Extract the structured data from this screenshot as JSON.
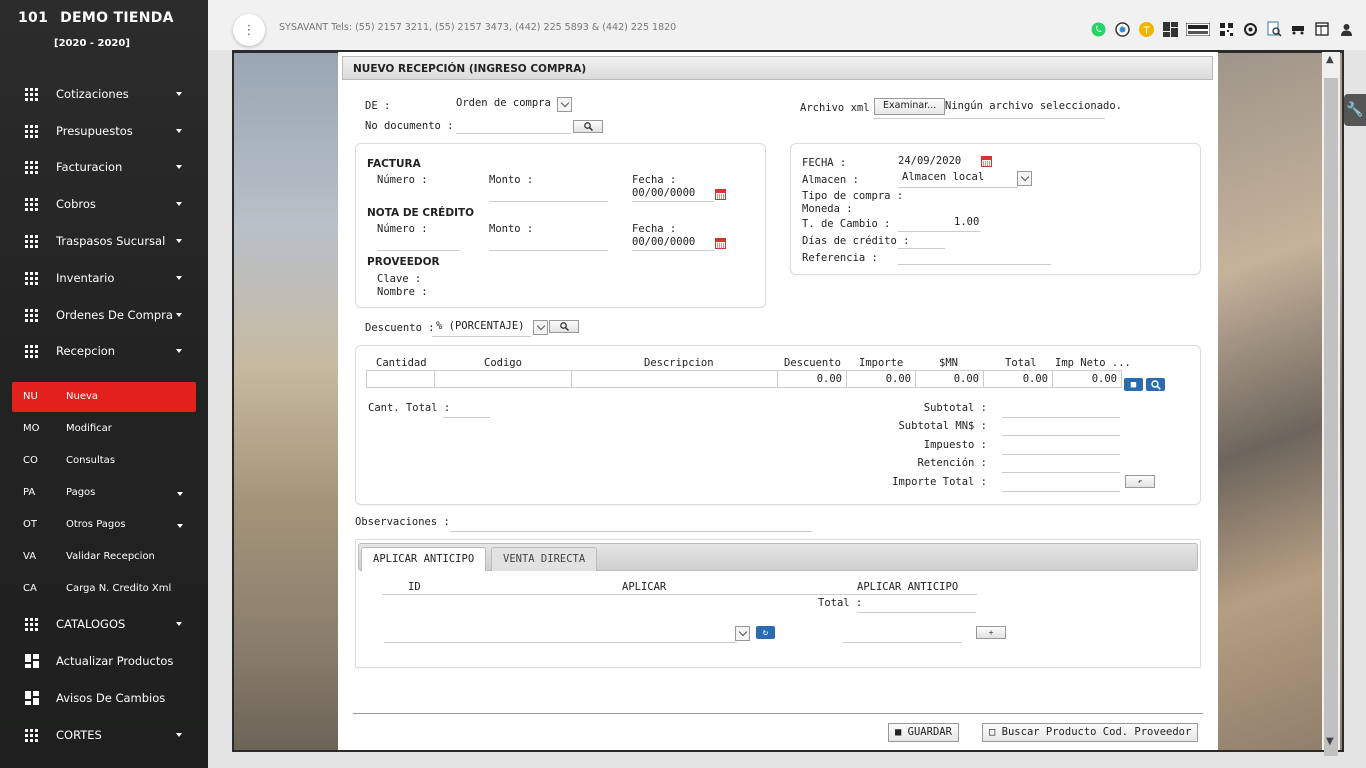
{
  "brand": {
    "number": "101",
    "name": "DEMO TIENDA",
    "period": "[2020 - 2020]"
  },
  "menu": [
    {
      "label": "Cotizaciones",
      "icon": "grid-icon"
    },
    {
      "label": "Presupuestos",
      "icon": "grid-icon"
    },
    {
      "label": "Facturacion",
      "icon": "grid-icon"
    },
    {
      "label": "Cobros",
      "icon": "grid-icon"
    },
    {
      "label": "Traspasos Sucursal",
      "icon": "grid-icon"
    },
    {
      "label": "Inventario",
      "icon": "grid-icon"
    },
    {
      "label": "Ordenes De Compra",
      "icon": "grid-icon"
    },
    {
      "label": "Recepcion",
      "icon": "grid-icon"
    }
  ],
  "submenu": [
    {
      "ab": "NU",
      "label": "Nueva"
    },
    {
      "ab": "MO",
      "label": "Modificar"
    },
    {
      "ab": "CO",
      "label": "Consultas"
    },
    {
      "ab": "PA",
      "label": "Pagos"
    },
    {
      "ab": "OT",
      "label": "Otros Pagos"
    },
    {
      "ab": "VA",
      "label": "Validar Recepcion"
    },
    {
      "ab": "CA",
      "label": "Carga N. Credito Xml"
    }
  ],
  "menu2": [
    {
      "label": "CATALOGOS",
      "icon": "grid-icon"
    },
    {
      "label": "Actualizar Productos",
      "icon": "tiles-icon"
    },
    {
      "label": "Avisos De Cambios",
      "icon": "tiles-icon"
    },
    {
      "label": "CORTES",
      "icon": "grid-icon"
    }
  ],
  "topbar": {
    "text": "SYSAVANT Tels: (55) 2157 3211, (55) 2157 3473, (442) 225 5893 & (442) 225 1820"
  },
  "form": {
    "title": "NUEVO RECEPCIÓN (INGRESO COMPRA)",
    "de_label": "DE :",
    "de_value": "Orden de compra",
    "nodoc_label": "No documento :",
    "xml_label": "Archivo xml :",
    "xml_button": "Examinar...",
    "xml_status": "Ningún archivo seleccionado.",
    "factura_title": "FACTURA",
    "numero_label": "Número :",
    "monto_label": "Monto :",
    "fecha_label": "Fecha :",
    "fecha_value": "00/00/0000",
    "nota_title": "NOTA DE CRÉDITO",
    "proveedor_title": "PROVEEDOR",
    "clave_label": "Clave :",
    "nombre_label": "Nombre :",
    "r_fecha_label": "FECHA :",
    "r_fecha_value": "24/09/2020",
    "almacen_label": "Almacen :",
    "almacen_value": "Almacen local",
    "tipo_label": "Tipo de compra :",
    "moneda_label": "Moneda :",
    "tcambio_label": "T. de Cambio :",
    "tcambio_value": "1.00",
    "dias_label": "Días de crédito :",
    "ref_label": "Referencia :",
    "descuento_label": "Descuento :",
    "descuento_value": "% (PORCENTAJE)"
  },
  "table": {
    "headers": [
      "Cantidad",
      "Codigo",
      "Descripcion",
      "Descuento",
      "Importe",
      "$MN",
      "Total",
      "Imp Neto ..."
    ],
    "row": [
      "",
      "",
      "",
      "0.00",
      "0.00",
      "0.00",
      "0.00",
      "0.00"
    ]
  },
  "totals": {
    "cant_total_label": "Cant. Total :",
    "subtotal": "Subtotal :",
    "subtotal_mn": "Subtotal MN$ :",
    "impuesto": "Impuesto :",
    "retencion": "Retención :",
    "importe_total": "Importe Total :"
  },
  "observaciones_label": "Observaciones :",
  "tabs": {
    "t1": "APLICAR ANTICIPO",
    "t2": "VENTA DIRECTA",
    "col_id": "ID",
    "col_aplicar": "APLICAR",
    "col_anticipo": "APLICAR ANTICIPO",
    "total_label": "Total :"
  },
  "buttons": {
    "guardar": "GUARDAR",
    "buscar": "Buscar Producto Cod. Proveedor"
  }
}
